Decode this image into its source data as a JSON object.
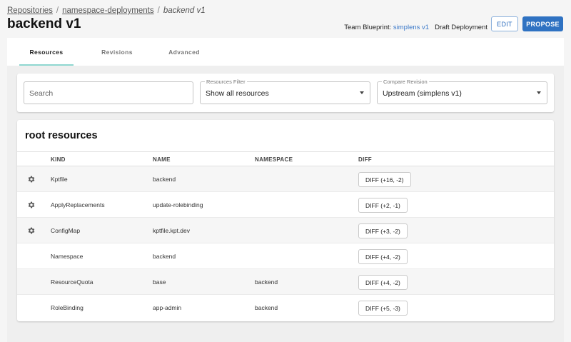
{
  "breadcrumb": {
    "items": [
      "Repositories",
      "namespace-deployments"
    ],
    "separator": "/",
    "current": "backend v1"
  },
  "page": {
    "title": "backend v1"
  },
  "meta": {
    "blueprint_label": "Team Blueprint:",
    "blueprint_link": "simplens v1",
    "status": "Draft Deployment"
  },
  "actions": {
    "edit": "EDIT",
    "propose": "PROPOSE"
  },
  "tabs": [
    {
      "label": "Resources",
      "active": true
    },
    {
      "label": "Revisions",
      "active": false
    },
    {
      "label": "Advanced",
      "active": false
    }
  ],
  "filters": {
    "search_placeholder": "Search",
    "resources_filter_label": "Resources Filter",
    "resources_filter_value": "Show all resources",
    "compare_label": "Compare Revision",
    "compare_value": "Upstream (simplens v1)"
  },
  "table": {
    "title": "root resources",
    "columns": [
      "KIND",
      "NAME",
      "NAMESPACE",
      "DIFF"
    ],
    "rows": [
      {
        "gear": true,
        "kind": "Kptfile",
        "name": "backend",
        "namespace": "",
        "diff": "DIFF (+16, -2)"
      },
      {
        "gear": true,
        "kind": "ApplyReplacements",
        "name": "update-rolebinding",
        "namespace": "",
        "diff": "DIFF (+2, -1)"
      },
      {
        "gear": true,
        "kind": "ConfigMap",
        "name": "kptfile.kpt.dev",
        "namespace": "",
        "diff": "DIFF (+3, -2)"
      },
      {
        "gear": false,
        "kind": "Namespace",
        "name": "backend",
        "namespace": "",
        "diff": "DIFF (+4, -2)"
      },
      {
        "gear": false,
        "kind": "ResourceQuota",
        "name": "base",
        "namespace": "backend",
        "diff": "DIFF (+4, -2)"
      },
      {
        "gear": false,
        "kind": "RoleBinding",
        "name": "app-admin",
        "namespace": "backend",
        "diff": "DIFF (+5, -3)"
      }
    ]
  },
  "colors": {
    "accent": "#2f72c2",
    "link": "#3a78c9",
    "tab_indicator": "#8fd7d0"
  },
  "icons": {
    "row_settings": "gear-icon",
    "select_caret": "caret-down-icon"
  }
}
